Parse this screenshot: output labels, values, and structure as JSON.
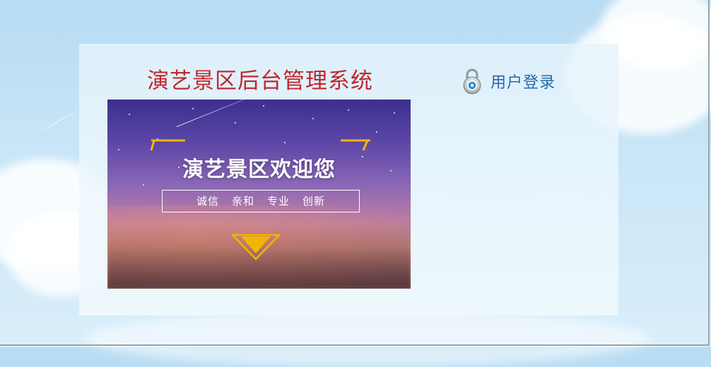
{
  "header": {
    "title": "演艺景区后台管理系统"
  },
  "login": {
    "label": "用户登录",
    "icon": "lock-icon"
  },
  "banner": {
    "welcome": "演艺景区欢迎您",
    "slogans": [
      "诚信",
      "亲和",
      "专业",
      "创新"
    ]
  },
  "colors": {
    "title": "#c1272d",
    "login": "#2468b0",
    "accent": "#f4b400"
  }
}
